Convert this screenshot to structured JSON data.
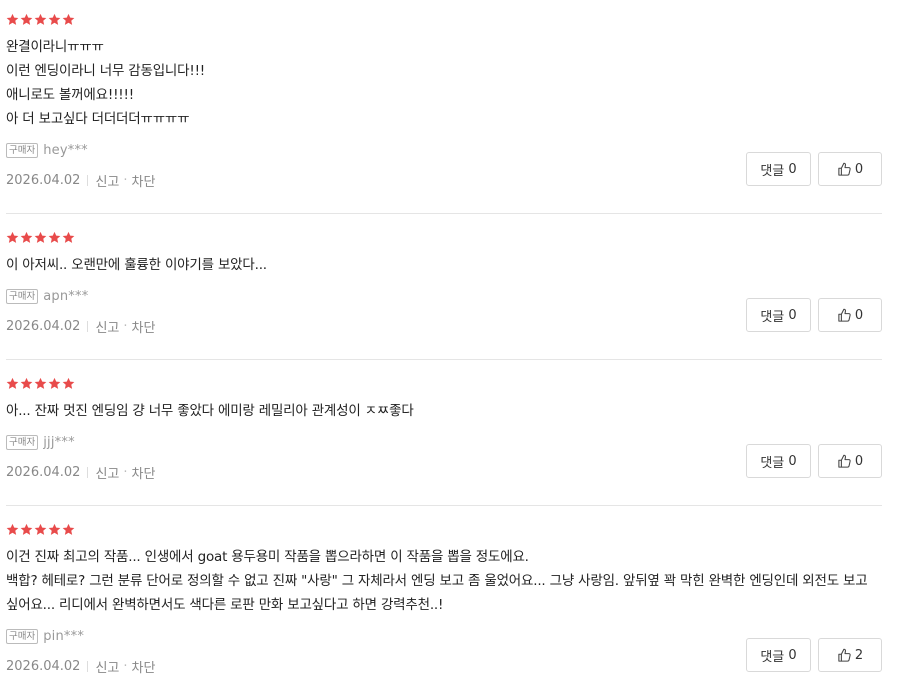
{
  "colors": {
    "star": "#e84b4b",
    "text": "#222222",
    "muted": "#999999",
    "border": "#d9d9d9"
  },
  "icons": {
    "star": "star-icon",
    "like": "thumbs-up-icon"
  },
  "reviews": [
    {
      "rating": 5,
      "lines": [
        "완결이라니ㅠㅠㅠ",
        "이런 엔딩이라니 너무 감동입니다!!!",
        "애니로도 볼꺼에요!!!!!",
        "아 더 보고싶다 더더더더ㅠㅠㅠㅠ"
      ],
      "badge": "구매자",
      "user": "hey***",
      "date": "2026.04.02",
      "report": "신고",
      "block": "차단",
      "comment_label": "댓글",
      "comment_count": "0",
      "like_count": "0"
    },
    {
      "rating": 5,
      "lines": [
        "이 아저씨.. 오랜만에 훌륭한 이야기를 보았다..."
      ],
      "badge": "구매자",
      "user": "apn***",
      "date": "2026.04.02",
      "report": "신고",
      "block": "차단",
      "comment_label": "댓글",
      "comment_count": "0",
      "like_count": "0"
    },
    {
      "rating": 5,
      "lines": [
        "아... 잔짜 멋진 엔딩임 걍 너무 좋았다 에미랑 레밀리아 관계성이 ㅈㅉ좋다"
      ],
      "badge": "구매자",
      "user": "jjj***",
      "date": "2026.04.02",
      "report": "신고",
      "block": "차단",
      "comment_label": "댓글",
      "comment_count": "0",
      "like_count": "0"
    },
    {
      "rating": 5,
      "lines": [
        "이건 진짜 최고의 작품... 인생에서 goat 용두용미 작품을 뽑으라하면 이 작품을 뽑을 정도에요.",
        "백합? 헤테로? 그런 분류 단어로 정의할 수 없고 진짜 \"사랑\" 그 자체라서 엔딩 보고 좀 울었어요... 그냥 사랑임. 앞뒤옆 꽉 막힌 완벽한 엔딩인데 외전도 보고 싶어요... 리디에서 완벽하면서도 색다른 로판 만화 보고싶다고 하면 강력추천..!"
      ],
      "badge": "구매자",
      "user": "pin***",
      "date": "2026.04.02",
      "report": "신고",
      "block": "차단",
      "comment_label": "댓글",
      "comment_count": "0",
      "like_count": "2"
    }
  ]
}
